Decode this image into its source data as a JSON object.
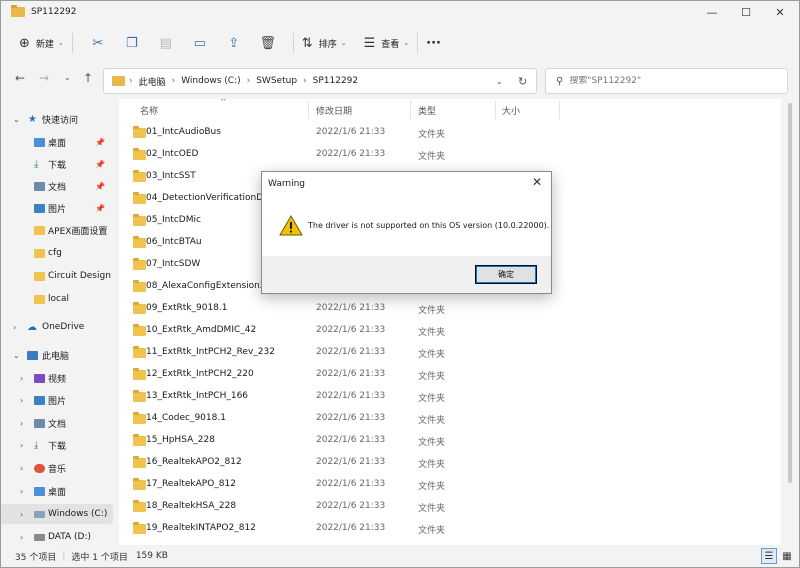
{
  "window": {
    "title": "SP112292",
    "controls": {
      "minimize": "—",
      "maximize": "☐",
      "close": "✕"
    }
  },
  "toolbar": {
    "new_label": "新建",
    "sort_label": "排序",
    "view_label": "查看",
    "more_label": "···"
  },
  "address": {
    "crumbs": [
      "此电脑",
      "Windows (C:)",
      "SWSetup",
      "SP112292"
    ],
    "search_placeholder": "搜索\"SP112292\""
  },
  "sidebar": {
    "quick_access": "快速访问",
    "quick_items": [
      "桌面",
      "下载",
      "文档",
      "图片",
      "APEX画面设置",
      "cfg",
      "Circuit Design",
      "local"
    ],
    "onedrive": "OneDrive",
    "this_pc": "此电脑",
    "pc_items": [
      "视频",
      "图片",
      "文档",
      "下载",
      "音乐",
      "桌面",
      "Windows (C:)",
      "DATA (D:)"
    ]
  },
  "columns": {
    "name": "名称",
    "date": "修改日期",
    "type": "类型",
    "size": "大小"
  },
  "files": [
    {
      "name": "01_IntcAudioBus",
      "date": "2022/1/6 21:33",
      "type": "文件夹"
    },
    {
      "name": "02_IntcOED",
      "date": "2022/1/6 21:33",
      "type": "文件夹"
    },
    {
      "name": "03_IntcSST",
      "date": "",
      "type": ""
    },
    {
      "name": "04_DetectionVerificationDrv",
      "date": "",
      "type": ""
    },
    {
      "name": "05_IntcDMic",
      "date": "",
      "type": ""
    },
    {
      "name": "06_IntcBTAu",
      "date": "",
      "type": ""
    },
    {
      "name": "07_IntcSDW",
      "date": "",
      "type": ""
    },
    {
      "name": "08_AlexaConfigExtension2_9",
      "date": "",
      "type": ""
    },
    {
      "name": "09_ExtRtk_9018.1",
      "date": "2022/1/6 21:33",
      "type": "文件夹"
    },
    {
      "name": "10_ExtRtk_AmdDMIC_42",
      "date": "2022/1/6 21:33",
      "type": "文件夹"
    },
    {
      "name": "11_ExtRtk_IntPCH2_Rev_232",
      "date": "2022/1/6 21:33",
      "type": "文件夹"
    },
    {
      "name": "12_ExtRtk_IntPCH2_220",
      "date": "2022/1/6 21:33",
      "type": "文件夹"
    },
    {
      "name": "13_ExtRtk_IntPCH_166",
      "date": "2022/1/6 21:33",
      "type": "文件夹"
    },
    {
      "name": "14_Codec_9018.1",
      "date": "2022/1/6 21:33",
      "type": "文件夹"
    },
    {
      "name": "15_HpHSA_228",
      "date": "2022/1/6 21:33",
      "type": "文件夹"
    },
    {
      "name": "16_RealtekAPO2_812",
      "date": "2022/1/6 21:33",
      "type": "文件夹"
    },
    {
      "name": "17_RealtekAPO_812",
      "date": "2022/1/6 21:33",
      "type": "文件夹"
    },
    {
      "name": "18_RealtekHSA_228",
      "date": "2022/1/6 21:33",
      "type": "文件夹"
    },
    {
      "name": "19_RealtekINTAPO2_812",
      "date": "2022/1/6 21:33",
      "type": "文件夹"
    }
  ],
  "status": {
    "count": "35 个项目",
    "selected": "选中 1 个项目",
    "size": "159 KB"
  },
  "dialog": {
    "title": "Warning",
    "close": "✕",
    "message": "The driver is not supported on this OS version (10.0.22000).",
    "ok_label": "确定"
  },
  "colors": {
    "folder": "#f0c34e",
    "accent": "#0078d7",
    "warning": "#f2c200"
  }
}
